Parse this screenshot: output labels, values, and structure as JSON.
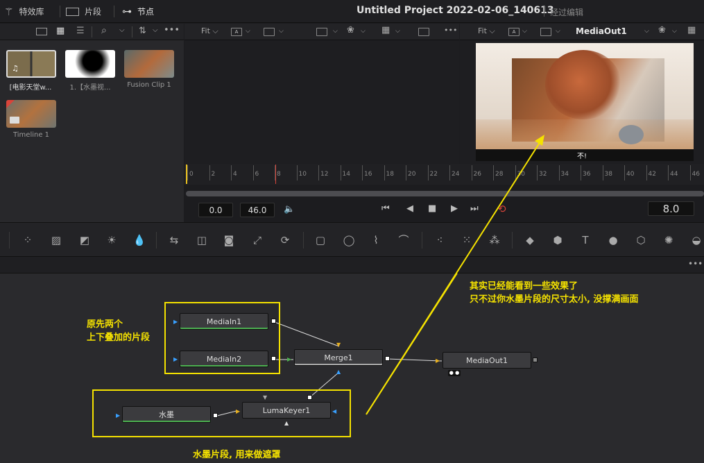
{
  "topbar": {
    "effects_label": "特效库",
    "clips_label": "片段",
    "nodes_label": "节点",
    "project_title": "Untitled Project 2022-02-06_140613",
    "edited_label": "经过编辑"
  },
  "media_pool": {
    "clips": [
      {
        "label": "[电影天堂w..."
      },
      {
        "label": "1.【水墨视..."
      },
      {
        "label": "Fusion Clip 1"
      },
      {
        "label": "Timeline 1"
      }
    ]
  },
  "viewer_left": {
    "fit_label": "Fit"
  },
  "viewer_right": {
    "fit_label": "Fit",
    "node_name": "MediaOut1"
  },
  "video": {
    "subtitle": "不!"
  },
  "ruler": {
    "ticks": [
      "0",
      "2",
      "4",
      "6",
      "8",
      "10",
      "12",
      "14",
      "16",
      "18",
      "20",
      "22",
      "24",
      "26",
      "28",
      "30",
      "32",
      "34",
      "36",
      "38",
      "40",
      "42",
      "44",
      "46"
    ]
  },
  "transport": {
    "start": "0.0",
    "end": "46.0",
    "current": "8.0"
  },
  "nodes": {
    "mediain1": "MediaIn1",
    "mediain2": "MediaIn2",
    "merge1": "Merge1",
    "mediaout1": "MediaOut1",
    "ink": "水墨",
    "lumakeyer1": "LumaKeyer1"
  },
  "annotations": {
    "original": [
      "原先两个",
      "上下叠加的片段"
    ],
    "effect": [
      "其实已经能看到一些效果了",
      "只不过你水墨片段的尺寸太小, 没撑满画面"
    ],
    "ink_mask": "水墨片段, 用来做遮罩"
  },
  "colors": {
    "annotation": "#f5e200",
    "accent_red": "#d9443a",
    "link_green": "#4caf50"
  }
}
